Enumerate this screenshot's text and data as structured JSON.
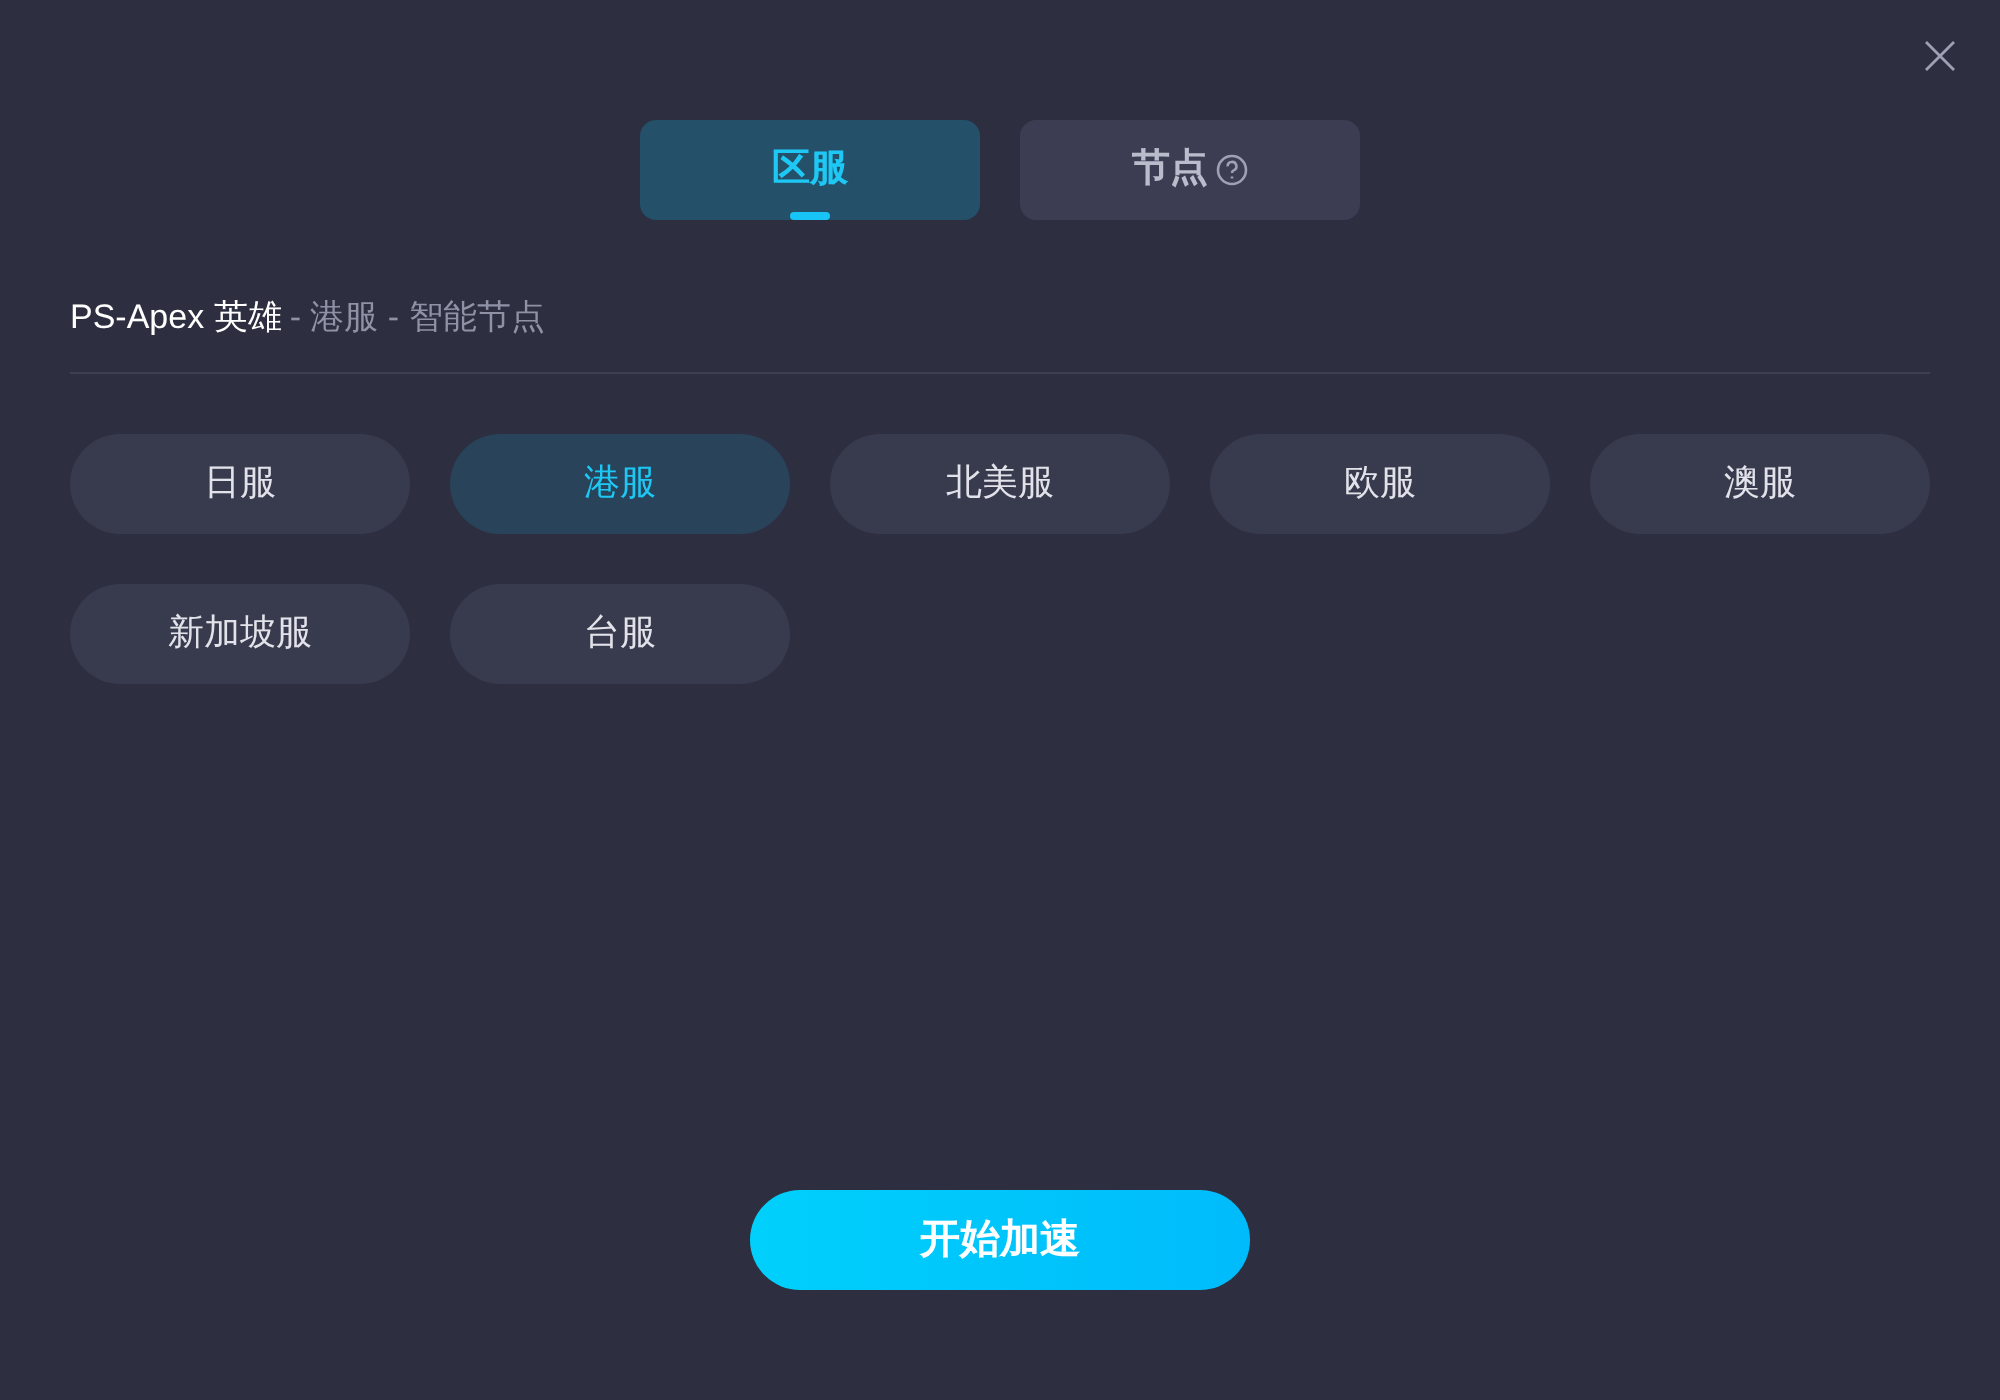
{
  "tabs": [
    {
      "label": "区服",
      "selected": true,
      "help": false
    },
    {
      "label": "节点",
      "selected": false,
      "help": true
    }
  ],
  "breadcrumb": {
    "game": "PS-Apex 英雄",
    "path": "- 港服 - 智能节点"
  },
  "regions": [
    {
      "label": "日服",
      "selected": false
    },
    {
      "label": "港服",
      "selected": true
    },
    {
      "label": "北美服",
      "selected": false
    },
    {
      "label": "欧服",
      "selected": false
    },
    {
      "label": "澳服",
      "selected": false
    },
    {
      "label": "新加坡服",
      "selected": false
    },
    {
      "label": "台服",
      "selected": false
    }
  ],
  "start_button": "开始加速"
}
